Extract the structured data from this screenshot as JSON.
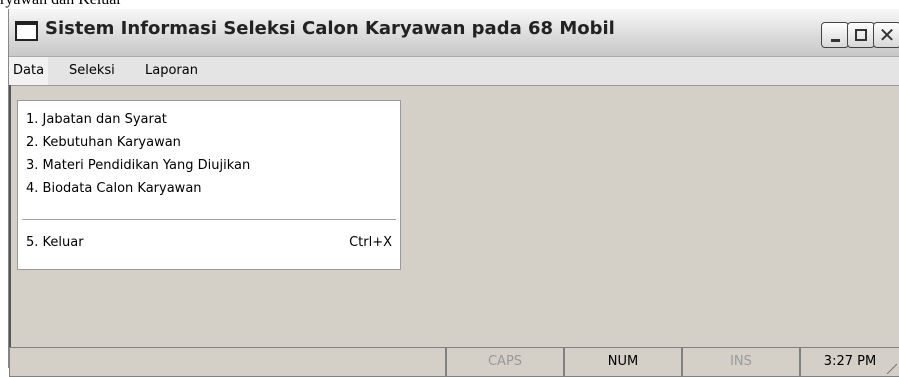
{
  "background_text": "ryawan dan Keluar",
  "window": {
    "title": "Sistem Informasi Seleksi Calon Karyawan pada 68 Mobil"
  },
  "menubar": {
    "items": [
      {
        "label": "Data"
      },
      {
        "label": "Seleksi"
      },
      {
        "label": "Laporan"
      }
    ]
  },
  "dropdown": {
    "items": [
      {
        "label": "1. Jabatan dan Syarat"
      },
      {
        "label": "2. Kebutuhan Karyawan"
      },
      {
        "label": "3. Materi Pendidikan Yang Diujikan"
      },
      {
        "label": "4. Biodata Calon Karyawan"
      }
    ],
    "exit": {
      "label": "5. Keluar",
      "shortcut": "Ctrl+X"
    }
  },
  "statusbar": {
    "main": "",
    "caps": "CAPS",
    "num": "NUM",
    "ins": "INS",
    "time": "3:27 PM"
  },
  "colors": {
    "window_bg": "#d4d0c8",
    "menu_bg": "#e4e4e4",
    "dropdown_bg": "#ffffff",
    "disabled_text": "#9a9a9a"
  },
  "icons": {
    "app": "window-icon",
    "minimize": "minimize-icon",
    "maximize": "maximize-icon",
    "close": "close-icon"
  }
}
